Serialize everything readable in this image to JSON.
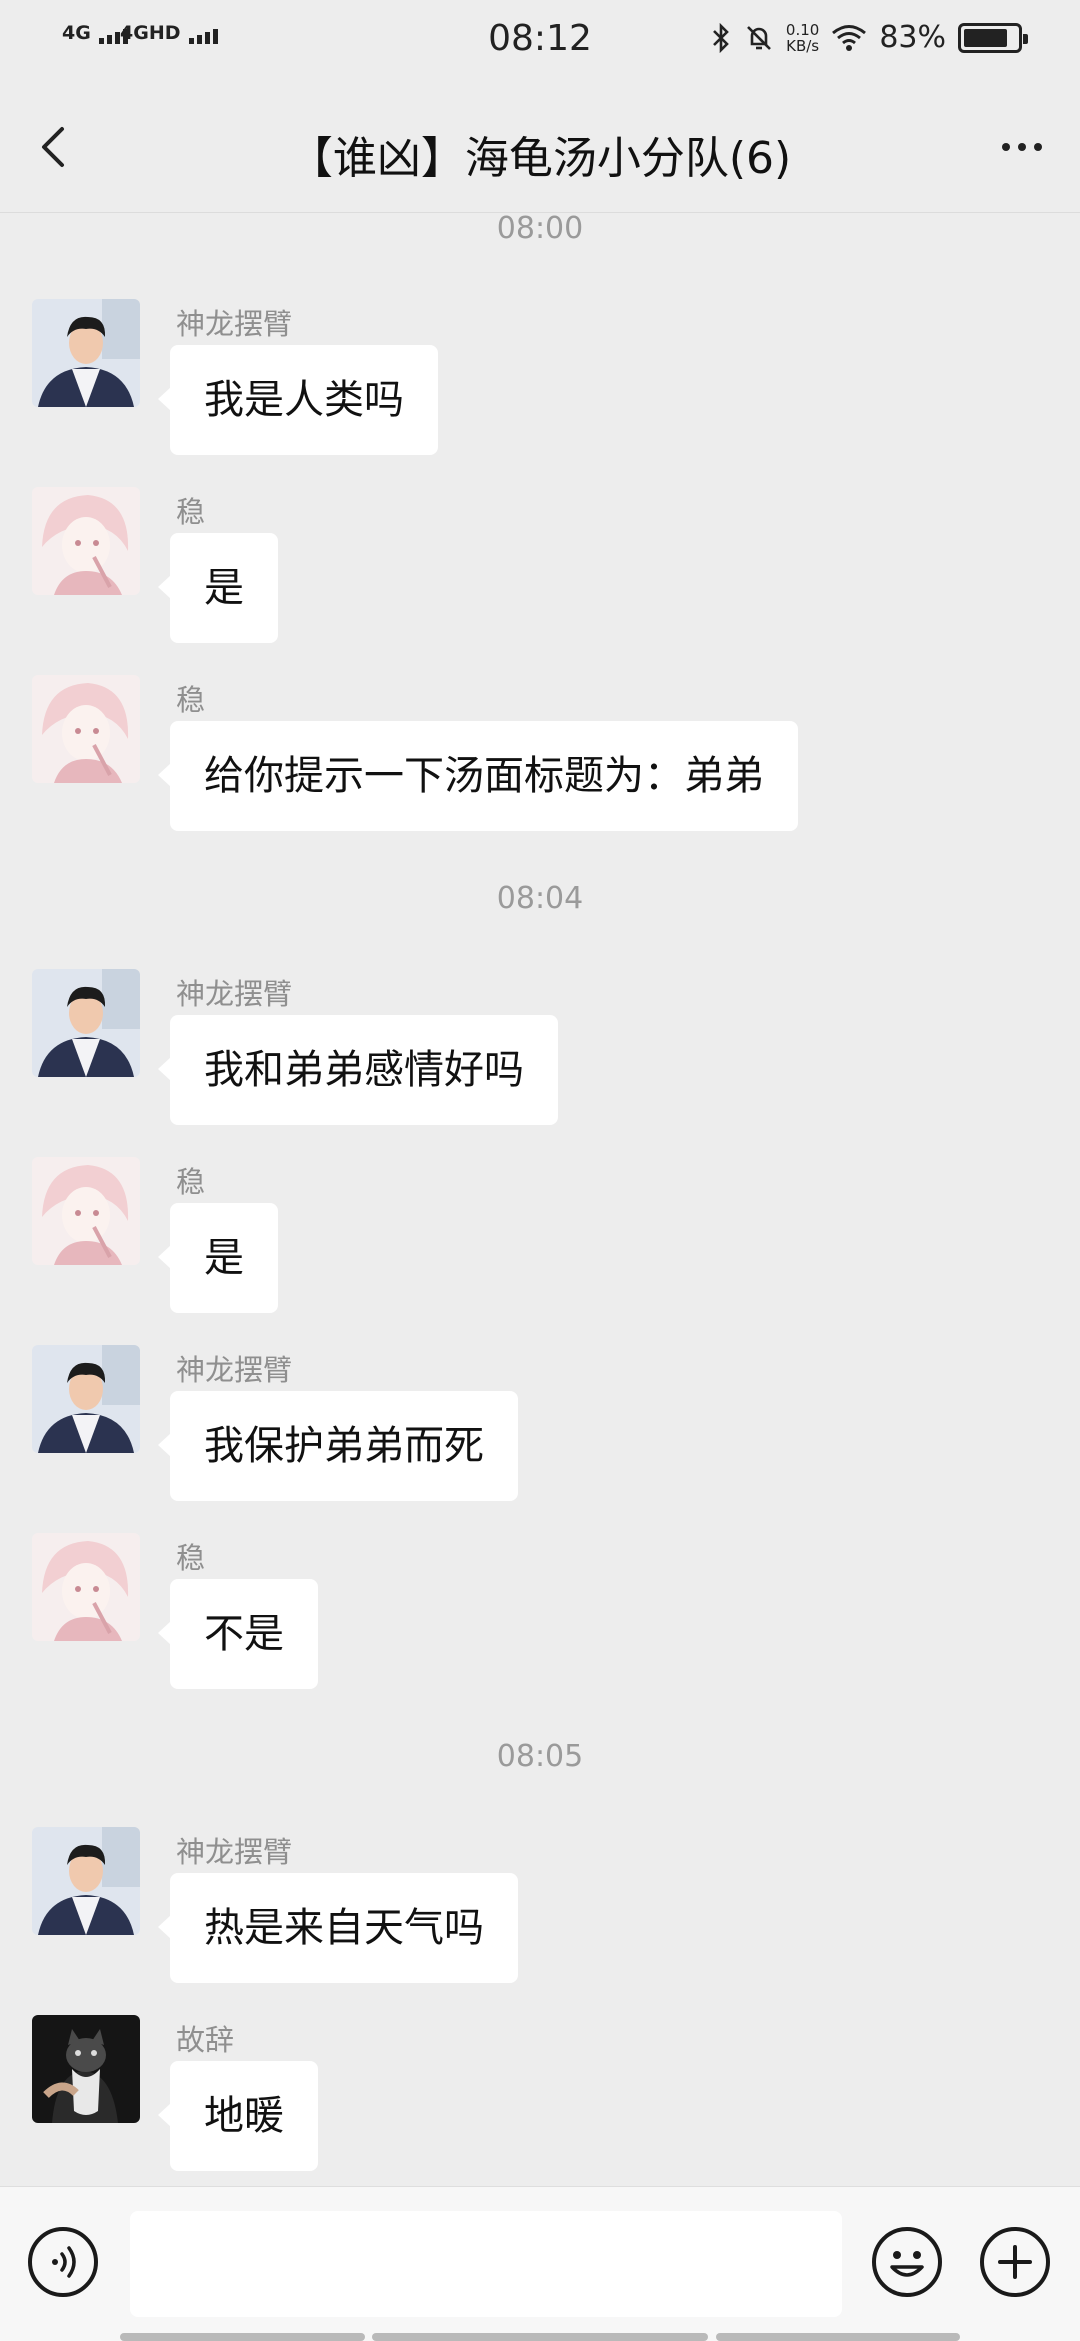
{
  "status_bar": {
    "signal1": "4G",
    "signal2": "4GHD",
    "time": "08:12",
    "speed_value": "0.10",
    "speed_unit": "KB/s",
    "battery_text": "83%",
    "battery_level": 0.83
  },
  "nav": {
    "title": "【谁凶】海龟汤小分队(6)",
    "back_icon": "chevron-left-icon",
    "more_icon": "more-dots-icon"
  },
  "chat": {
    "time_separators": [
      "08:00",
      "08:04",
      "08:05"
    ],
    "messages": [
      {
        "sender": "神龙摆臂",
        "text": "我是人类吗",
        "avatar": "man-avatar"
      },
      {
        "sender": "稳",
        "text": "是",
        "avatar": "anime-avatar"
      },
      {
        "sender": "稳",
        "text": "给你提示一下汤面标题为：弟弟",
        "avatar": "anime-avatar"
      },
      {
        "sender": "神龙摆臂",
        "text": "我和弟弟感情好吗",
        "avatar": "man-avatar"
      },
      {
        "sender": "稳",
        "text": "是",
        "avatar": "anime-avatar"
      },
      {
        "sender": "神龙摆臂",
        "text": "我保护弟弟而死",
        "avatar": "man-avatar"
      },
      {
        "sender": "稳",
        "text": "不是",
        "avatar": "anime-avatar"
      },
      {
        "sender": "神龙摆臂",
        "text": "热是来自天气吗",
        "avatar": "man-avatar"
      },
      {
        "sender": "故辞",
        "text": "地暖",
        "avatar": "cat-avatar"
      }
    ]
  },
  "input_bar": {
    "text": "",
    "voice_icon": "voice-icon",
    "emoji_icon": "emoji-icon",
    "plus_icon": "plus-icon"
  }
}
